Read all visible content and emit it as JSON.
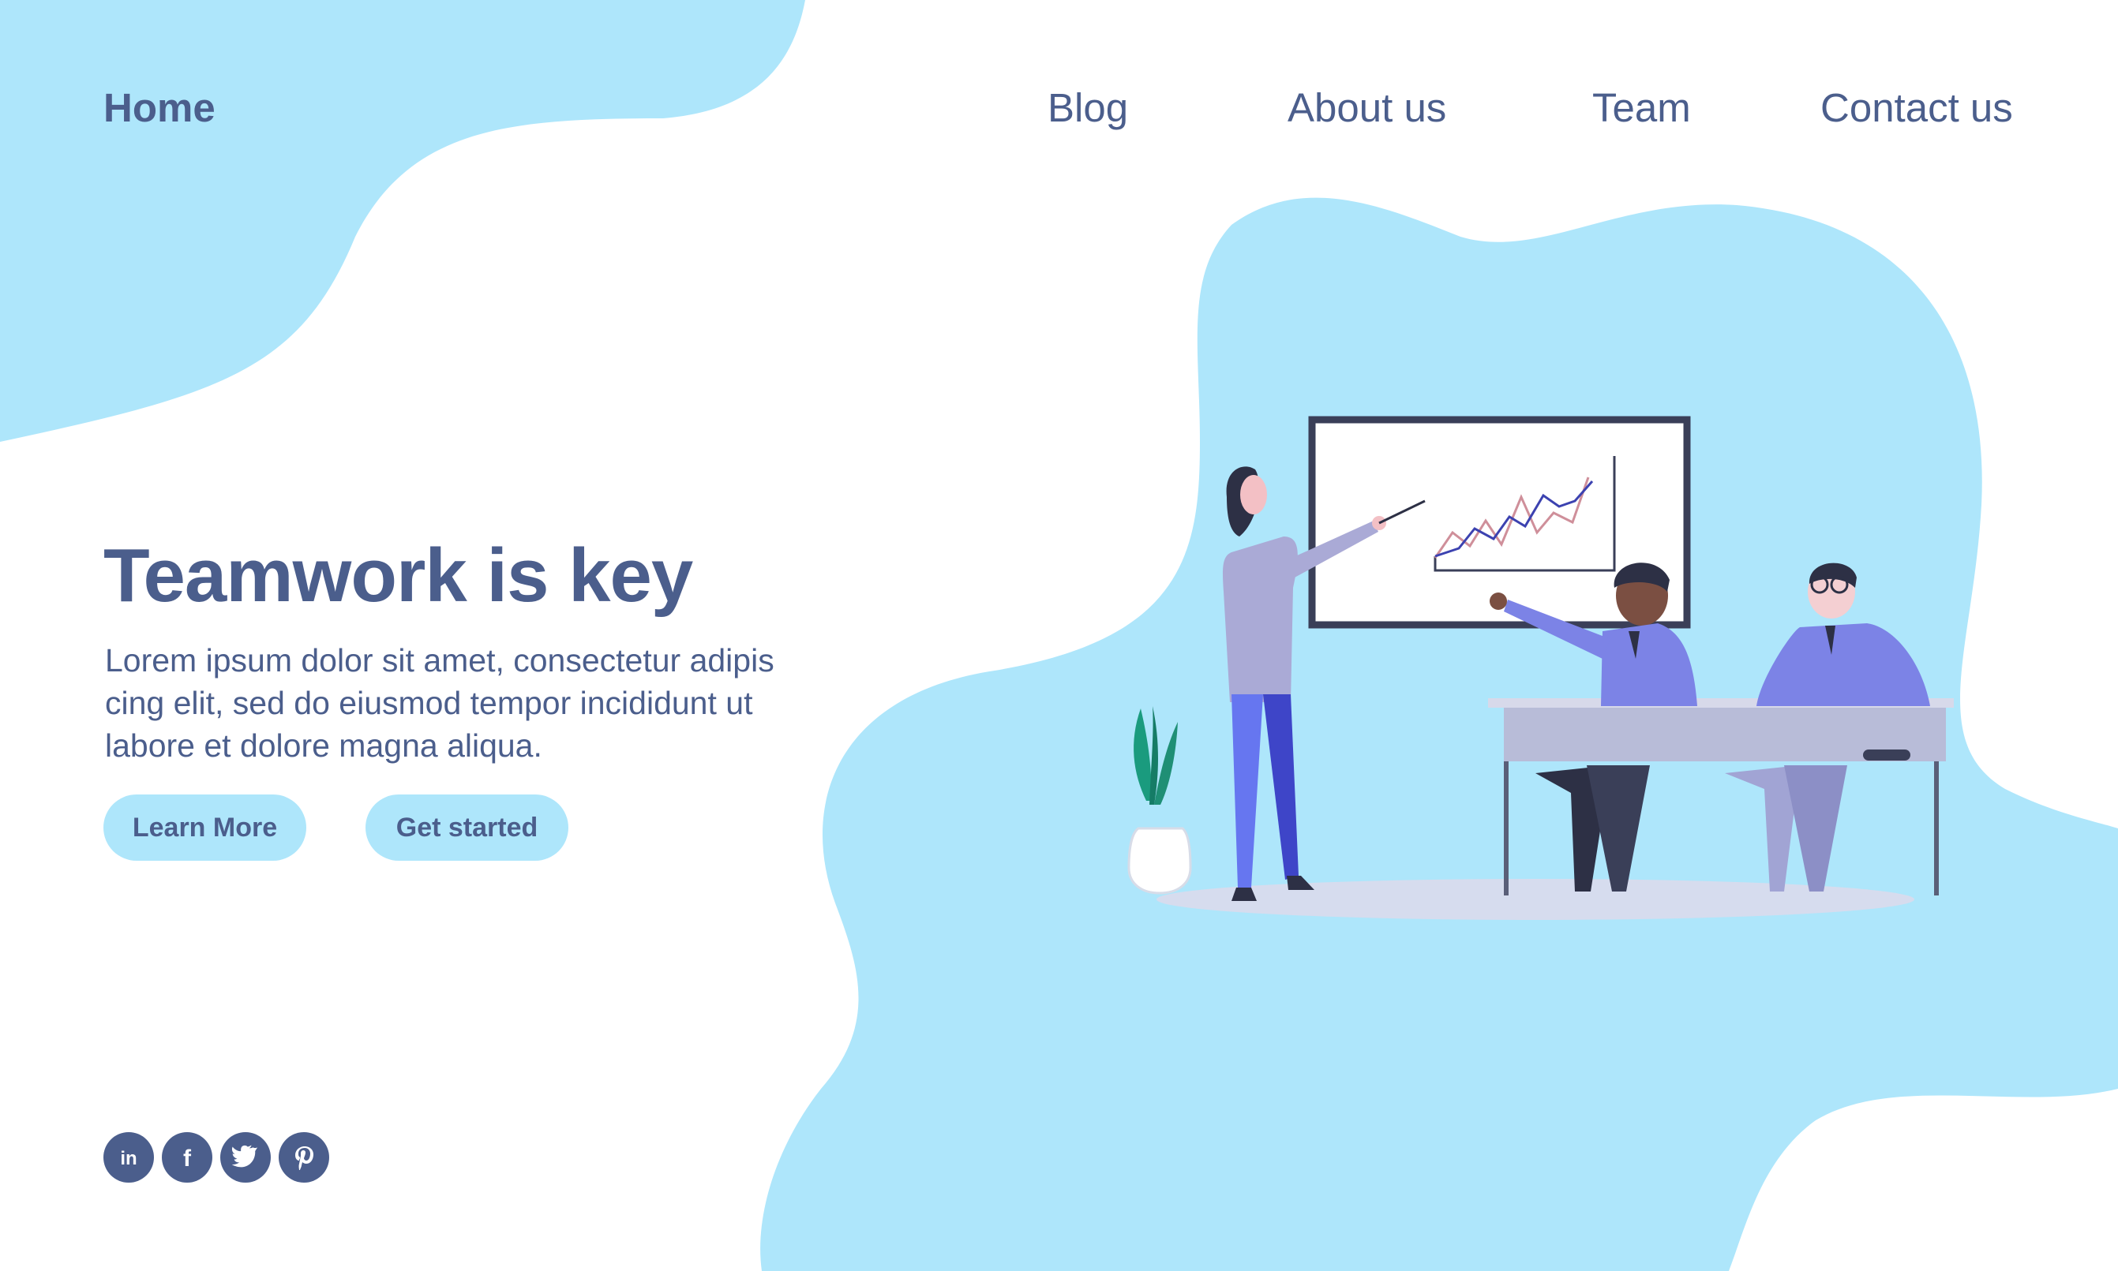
{
  "nav": {
    "home": "Home",
    "links": [
      "Blog",
      "About us",
      "Team",
      "Contact us"
    ]
  },
  "hero": {
    "title": "Teamwork is key",
    "text_lines": [
      "Lorem ipsum dolor sit amet, consectetur adipis",
      "cing elit, sed do eiusmod tempor incididunt ut",
      "labore et dolore magna aliqua."
    ],
    "buttons": {
      "learn": "Learn More",
      "start": "Get started"
    }
  },
  "social": [
    "linkedin-icon",
    "facebook-icon",
    "twitter-icon",
    "pinterest-icon"
  ],
  "colors": {
    "primary_text": "#4b5e8c",
    "accent_blob": "#aee6fb",
    "button_bg": "#aee6fb",
    "background": "#ffffff"
  }
}
